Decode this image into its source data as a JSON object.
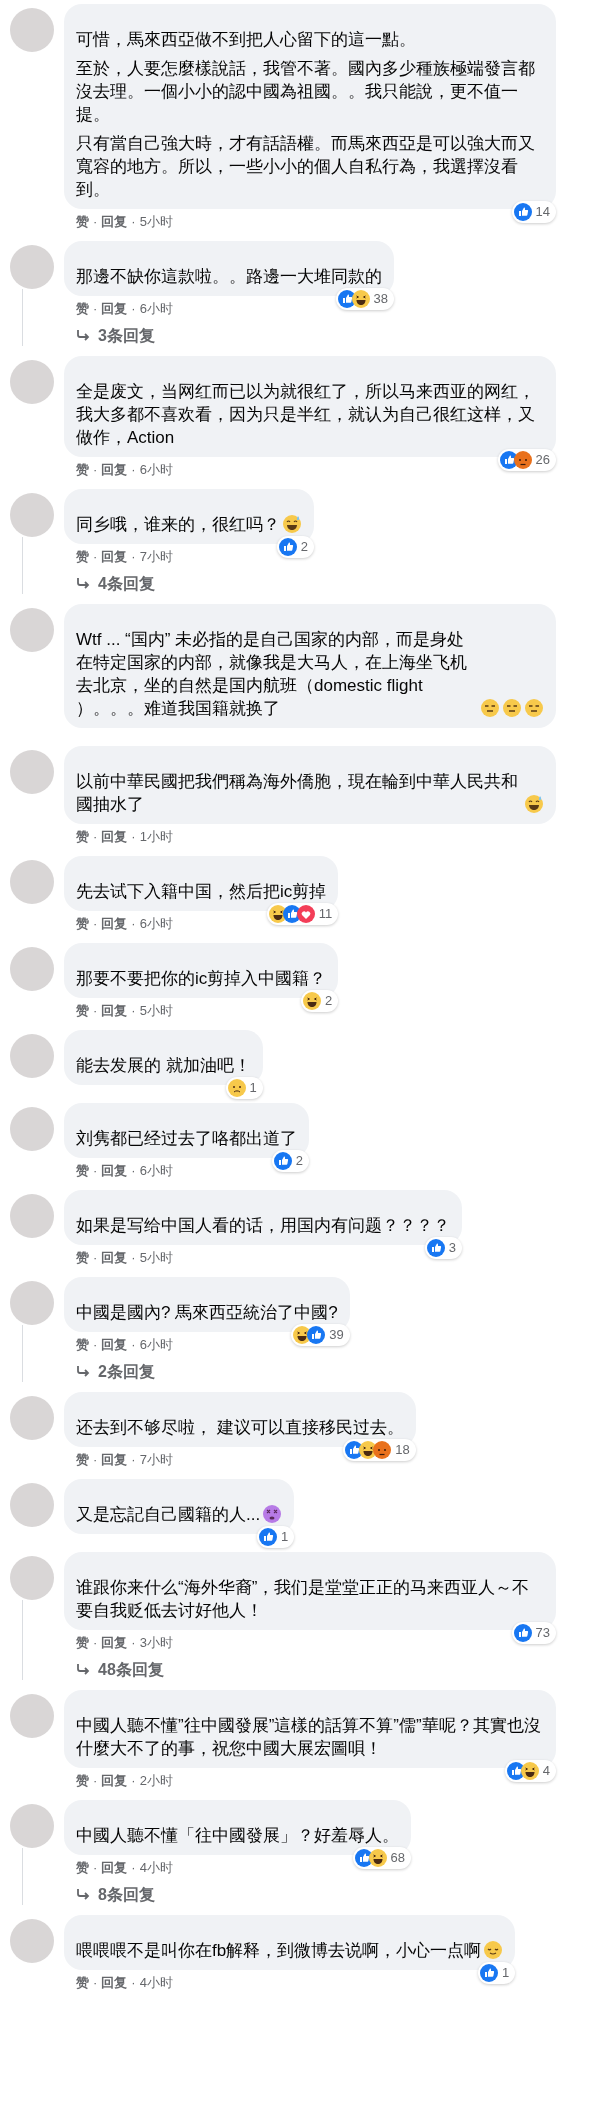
{
  "comments": [
    {
      "paragraphs": [
        "可惜，馬來西亞做不到把人心留下的這一點。",
        "至於，人要怎麼樣說話，我管不著。國內多少種族極端發言都沒去理。一個小小的認中國為祖國。。我只能說，更不值一提。",
        "只有當自己強大時，才有話語權。而馬來西亞是可以強大而又寬容的地方。所以，一些小小的個人自私行為，我選擇沒看到。"
      ],
      "reactions": [
        {
          "kind": "like"
        }
      ],
      "reaction_count": "14",
      "actions": {
        "like": "赞",
        "sep": "·",
        "reply": "回复",
        "time": "5小时"
      }
    },
    {
      "paragraphs": [
        "那邊不缺你這款啦。。路邊一大堆同款的"
      ],
      "reactions": [
        {
          "kind": "like"
        },
        {
          "kind": "haha"
        }
      ],
      "reaction_count": "38",
      "actions": {
        "like": "赞",
        "sep": "·",
        "reply": "回复",
        "time": "6小时"
      },
      "replies": "3条回复"
    },
    {
      "paragraphs": [
        "全是废文，当网红而已以为就很红了，所以马来西亚的网红，我大多都不喜欢看，因为只是半红，就认为自己很红这样，又做作，Action"
      ],
      "reactions": [
        {
          "kind": "like"
        },
        {
          "kind": "angry"
        }
      ],
      "reaction_count": "26",
      "actions": {
        "like": "赞",
        "sep": "·",
        "reply": "回复",
        "time": "6小时"
      }
    },
    {
      "paragraphs": [
        "同乡哦，谁来的，很红吗？"
      ],
      "emojis": [
        {
          "kind": "sweat-smile"
        }
      ],
      "reactions": [
        {
          "kind": "like"
        }
      ],
      "reaction_count": "2",
      "actions": {
        "like": "赞",
        "sep": "·",
        "reply": "回复",
        "time": "7小时"
      },
      "replies": "4条回复"
    },
    {
      "paragraphs": [
        "Wtf ... “国内” 未必指的是自己国家的内部，而是身处在特定国家的内部，就像我是大马人，在上海坐飞机去北京，坐的自然是国内航班（domestic flight ）。。。难道我国籍就换了"
      ],
      "emojis": [
        {
          "kind": "expressionless"
        },
        {
          "kind": "expressionless"
        },
        {
          "kind": "expressionless"
        }
      ]
    },
    {
      "paragraphs": [
        "以前中華民國把我們稱為海外僑胞，現在輪到中華人民共和國抽水了"
      ],
      "emojis": [
        {
          "kind": "sweat-smile"
        }
      ],
      "actions": {
        "like": "赞",
        "sep": "·",
        "reply": "回复",
        "time": "1小时"
      }
    },
    {
      "paragraphs": [
        "先去试下入籍中国，然后把ic剪掉"
      ],
      "reactions": [
        {
          "kind": "haha"
        },
        {
          "kind": "like"
        },
        {
          "kind": "love"
        }
      ],
      "reaction_count": "11",
      "actions": {
        "like": "赞",
        "sep": "·",
        "reply": "回复",
        "time": "6小时"
      }
    },
    {
      "paragraphs": [
        "那要不要把你的ic剪掉入中國籍？"
      ],
      "reactions": [
        {
          "kind": "haha"
        }
      ],
      "reaction_count": "2",
      "actions": {
        "like": "赞",
        "sep": "·",
        "reply": "回复",
        "time": "5小时"
      }
    },
    {
      "paragraphs": [
        "能去发展的 就加油吧！"
      ],
      "reactions": [
        {
          "kind": "sad"
        }
      ],
      "reaction_count": "1"
    },
    {
      "paragraphs": [
        "刘隽都已经过去了咯都出道了"
      ],
      "reactions": [
        {
          "kind": "like"
        }
      ],
      "reaction_count": "2",
      "actions": {
        "like": "赞",
        "sep": "·",
        "reply": "回复",
        "time": "6小时"
      }
    },
    {
      "paragraphs": [
        "如果是写给中国人看的话，用国内有问题？？？？"
      ],
      "reactions": [
        {
          "kind": "like"
        }
      ],
      "reaction_count": "3",
      "actions": {
        "like": "赞",
        "sep": "·",
        "reply": "回复",
        "time": "5小时"
      }
    },
    {
      "paragraphs": [
        "中國是國內? 馬來西亞統治了中國?"
      ],
      "reactions": [
        {
          "kind": "haha"
        },
        {
          "kind": "like"
        }
      ],
      "reaction_count": "39",
      "actions": {
        "like": "赞",
        "sep": "·",
        "reply": "回复",
        "time": "6小时"
      },
      "replies": "2条回复"
    },
    {
      "paragraphs": [
        "还去到不够尽啦， 建议可以直接移民过去。"
      ],
      "reactions": [
        {
          "kind": "like"
        },
        {
          "kind": "haha"
        },
        {
          "kind": "angry"
        }
      ],
      "reaction_count": "18",
      "actions": {
        "like": "赞",
        "sep": "·",
        "reply": "回复",
        "time": "7小时"
      }
    },
    {
      "paragraphs": [
        "又是忘記自己國籍的人..."
      ],
      "emojis": [
        {
          "kind": "dizzy"
        }
      ],
      "reactions": [
        {
          "kind": "like"
        }
      ],
      "reaction_count": "1"
    },
    {
      "paragraphs": [
        "谁跟你来什么“海外华裔”，我们是堂堂正正的马来西亚人～不要自我贬低去讨好他人！"
      ],
      "reactions": [
        {
          "kind": "like"
        }
      ],
      "reaction_count": "73",
      "actions": {
        "like": "赞",
        "sep": "·",
        "reply": "回复",
        "time": "3小时"
      },
      "replies": "48条回复"
    },
    {
      "paragraphs": [
        "中國人聽不懂”往中國發展”這樣的話算不算”儒”華呢？其實也沒什麼大不了的事，祝您中國大展宏圖唄！"
      ],
      "reactions": [
        {
          "kind": "like"
        },
        {
          "kind": "haha"
        }
      ],
      "reaction_count": "4",
      "actions": {
        "like": "赞",
        "sep": "·",
        "reply": "回复",
        "time": "2小时"
      }
    },
    {
      "paragraphs": [
        "中國人聽不懂「往中國發展」？好羞辱人。"
      ],
      "reactions": [
        {
          "kind": "like"
        },
        {
          "kind": "haha"
        }
      ],
      "reaction_count": "68",
      "actions": {
        "like": "赞",
        "sep": "·",
        "reply": "回复",
        "time": "4小时"
      },
      "replies": "8条回复"
    },
    {
      "paragraphs": [
        "喂喂喂不是叫你在fb解释，到微博去说啊，小心一点啊"
      ],
      "emojis": [
        {
          "kind": "relieved"
        }
      ],
      "reactions": [
        {
          "kind": "like"
        }
      ],
      "reaction_count": "1",
      "actions": {
        "like": "赞",
        "sep": "·",
        "reply": "回复",
        "time": "4小时"
      }
    }
  ]
}
